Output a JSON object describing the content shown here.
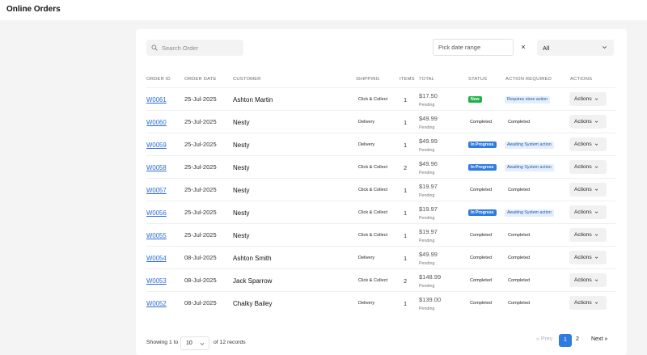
{
  "page": {
    "title": "Online Orders"
  },
  "toolbar": {
    "search_placeholder": "Search Order",
    "date_placeholder": "Pick date range",
    "clear_label": "×",
    "filter_value": "All"
  },
  "table": {
    "headers": {
      "order_id": "ORDER ID",
      "order_date": "ORDER DATE",
      "customer": "CUSTOMER",
      "shipping": "SHIPPING",
      "items": "ITEMS",
      "total": "TOTAL",
      "status": "STATUS",
      "action_required": "ACTION REQUIRED",
      "actions": "ACTIONS"
    },
    "rows": [
      {
        "order_id": "W0061",
        "date": "25-Jul-2025",
        "customer": "Ashton Martin",
        "shipping": "Click & Collect",
        "items": "1",
        "total": "$17.50",
        "total_status": "Pending",
        "status": "New",
        "status_style": "new",
        "action": "Requires store action",
        "action_style": "badge",
        "actions_label": "Actions"
      },
      {
        "order_id": "W0060",
        "date": "25-Jul-2025",
        "customer": "Nesty",
        "shipping": "Delivery",
        "items": "1",
        "total": "$49.99",
        "total_status": "Pending",
        "status": "Completed",
        "status_style": "plain",
        "action": "Completed",
        "action_style": "plain",
        "actions_label": "Actions"
      },
      {
        "order_id": "W0059",
        "date": "25-Jul-2025",
        "customer": "Nesty",
        "shipping": "Delivery",
        "items": "1",
        "total": "$49.99",
        "total_status": "Pending",
        "status": "In Progress",
        "status_style": "progress",
        "action": "Awaiting System action",
        "action_style": "badge",
        "actions_label": "Actions"
      },
      {
        "order_id": "W0058",
        "date": "25-Jul-2025",
        "customer": "Nesty",
        "shipping": "Click & Collect",
        "items": "2",
        "total": "$49.96",
        "total_status": "Pending",
        "status": "In Progress",
        "status_style": "progress",
        "action": "Awaiting System action",
        "action_style": "badge",
        "actions_label": "Actions"
      },
      {
        "order_id": "W0057",
        "date": "25-Jul-2025",
        "customer": "Nesty",
        "shipping": "Click & Collect",
        "items": "1",
        "total": "$19.97",
        "total_status": "Pending",
        "status": "Completed",
        "status_style": "plain",
        "action": "Completed",
        "action_style": "plain",
        "actions_label": "Actions"
      },
      {
        "order_id": "W0056",
        "date": "25-Jul-2025",
        "customer": "Nesty",
        "shipping": "Click & Collect",
        "items": "1",
        "total": "$19.97",
        "total_status": "Pending",
        "status": "In Progress",
        "status_style": "progress",
        "action": "Awaiting System action",
        "action_style": "badge",
        "actions_label": "Actions"
      },
      {
        "order_id": "W0055",
        "date": "25-Jul-2025",
        "customer": "Nesty",
        "shipping": "Click & Collect",
        "items": "1",
        "total": "$19.97",
        "total_status": "Pending",
        "status": "Completed",
        "status_style": "plain",
        "action": "Completed",
        "action_style": "plain",
        "actions_label": "Actions"
      },
      {
        "order_id": "W0054",
        "date": "08-Jul-2025",
        "customer": "Ashton Smith",
        "shipping": "Delivery",
        "items": "1",
        "total": "$49.99",
        "total_status": "Pending",
        "status": "Completed",
        "status_style": "plain",
        "action": "Completed",
        "action_style": "plain",
        "actions_label": "Actions"
      },
      {
        "order_id": "W0053",
        "date": "08-Jul-2025",
        "customer": "Jack Sparrow",
        "shipping": "Click & Collect",
        "items": "2",
        "total": "$148.99",
        "total_status": "Pending",
        "status": "Completed",
        "status_style": "plain",
        "action": "Completed",
        "action_style": "plain",
        "actions_label": "Actions"
      },
      {
        "order_id": "W0052",
        "date": "08-Jul-2025",
        "customer": "Chalky Bailey",
        "shipping": "Delivery",
        "items": "1",
        "total": "$139.00",
        "total_status": "Pending",
        "status": "Completed",
        "status_style": "plain",
        "action": "Completed",
        "action_style": "plain",
        "actions_label": "Actions"
      }
    ]
  },
  "footer": {
    "showing_prefix": "Showing 1 to",
    "per_page": "10",
    "records_text": "of 12 records",
    "prev_label": "« Prev",
    "pages": [
      "1",
      "2"
    ],
    "current_page": "1",
    "next_label": "Next »"
  },
  "colors": {
    "status_new": "#22b04b",
    "status_progress": "#2f7be0",
    "link": "#2a6dd4",
    "page_active": "#2f7be0"
  },
  "icons": {
    "search": "search-icon",
    "chevron": "chevron-down-icon"
  }
}
